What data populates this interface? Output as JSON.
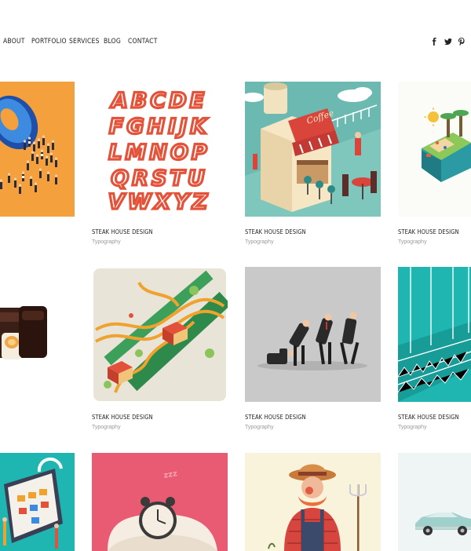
{
  "nav": {
    "items": [
      {
        "label": "ABOUT"
      },
      {
        "label": "PORTFOLIO"
      },
      {
        "label": "SERVICES"
      },
      {
        "label": "BLOG"
      },
      {
        "label": "CONTACT"
      }
    ],
    "social": [
      {
        "icon": "facebook-icon",
        "glyph": "f"
      },
      {
        "icon": "twitter-icon",
        "glyph": "t"
      },
      {
        "icon": "pinterest-icon",
        "glyph": "p"
      }
    ]
  },
  "alphabet": [
    "ABCDE",
    "FGHIJK",
    "LMNOP",
    "QRSTU",
    "VWXYZ"
  ],
  "cards": [
    {
      "title": "STEAK HOUSE DESIGN",
      "category": "Typography"
    },
    {
      "title": "STEAK HOUSE DESIGN",
      "category": "Typography"
    },
    {
      "title": "STEAK HOUSE DESIGN",
      "category": "Typography"
    },
    {
      "title": "STEAK HOUSE DESIGN",
      "category": "Typography"
    },
    {
      "title": "STEAK HOUSE DESIGN",
      "category": "Typography"
    },
    {
      "title": "STEAK HOUSE DESIGN",
      "category": "Typography"
    }
  ],
  "colors": {
    "orange": "#f4a03c",
    "teal": "#1fb5b0",
    "pink": "#e95a73",
    "cream": "#faf3dc",
    "letters": "#e5523a"
  }
}
